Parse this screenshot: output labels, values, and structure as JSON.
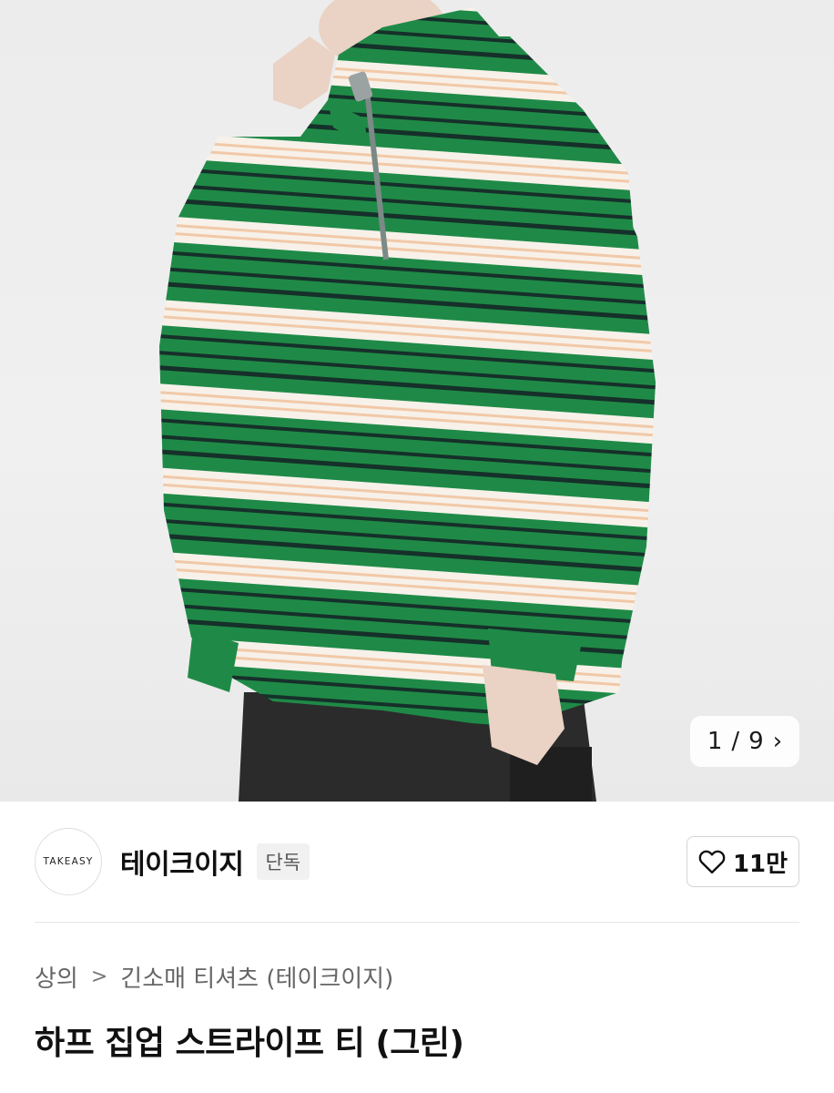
{
  "gallery": {
    "current": "1",
    "separator": "/",
    "total": "9",
    "next_icon": "chevron-right-icon",
    "image_subject": "green-white-striped-half-zip-long-sleeve-tee"
  },
  "brand": {
    "logo_text": "TAKEASY",
    "name": "테이크이지",
    "badge": "단독"
  },
  "like": {
    "icon": "heart-outline-icon",
    "count": "11만"
  },
  "breadcrumb": {
    "items": [
      "상의",
      "긴소매 티셔츠 (테이크이지)"
    ],
    "separator_icon": "chevron-right-icon"
  },
  "product": {
    "title": "하프 집업 스트라이프 티 (그린)"
  },
  "colors": {
    "shirt_green": "#1f8a47",
    "stripe_white": "#f7f1ea",
    "stripe_peach": "#f1c9a8",
    "stripe_navy": "#16302a"
  }
}
